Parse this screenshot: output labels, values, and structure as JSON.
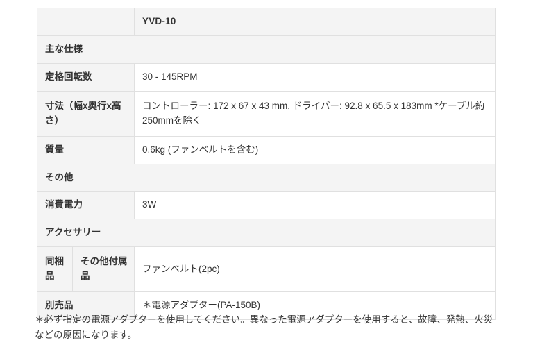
{
  "document": {
    "title": "YVD-10 Specification Table"
  },
  "table": {
    "rows": [
      {
        "type": "model",
        "label": "",
        "value": "YVD-10"
      },
      {
        "type": "section",
        "label": "主な仕様"
      },
      {
        "type": "spec",
        "label": "定格回転数",
        "value": "30 - 145RPM"
      },
      {
        "type": "spec",
        "label": "寸法（幅x奥行x高さ）",
        "value": "コントローラー: 172 x 67 x 43 mm, ドライバー: 92.8 x 65.5 x 183mm *ケーブル約250mmを除く"
      },
      {
        "type": "spec",
        "label": "質量",
        "value": "0.6kg (ファンベルトを含む)"
      },
      {
        "type": "section",
        "label": "その他"
      },
      {
        "type": "spec",
        "label": "消費電力",
        "value": "3W"
      },
      {
        "type": "section",
        "label": "アクセサリー"
      },
      {
        "type": "spec-sub",
        "label": "同梱品",
        "sublabel": "その他付属品",
        "value": "ファンベルト(2pc)"
      },
      {
        "type": "spec",
        "label": "別売品",
        "value": "＊電源アダプター(PA-150B)"
      }
    ]
  },
  "footnote": {
    "text": "＊必ず指定の電源アダプターを使用してください。異なった電源アダプターを使用すると、故障、発熱、火災などの原因になります。"
  },
  "colors": {
    "label_background": "#f4f4f4",
    "value_background": "#ffffff",
    "border": "#e0e0e0",
    "text": "#333333",
    "page_background": "#ffffff"
  }
}
